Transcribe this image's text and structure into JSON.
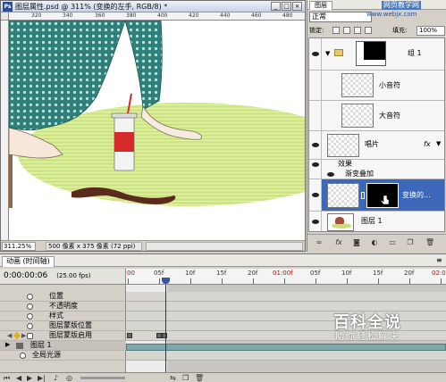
{
  "document": {
    "title": "图层属性.psd @ 311% (变换的左手, RGB/8) *",
    "ruler_labels": [
      "320",
      "340",
      "360",
      "380",
      "400",
      "420",
      "440",
      "460",
      "480",
      "500"
    ],
    "zoom": "311.25%",
    "info": "500 像素 x 375 像素 (72 ppi)"
  },
  "layers_panel": {
    "tab": "图层",
    "blend_mode": "正常",
    "lock_label": "锁定:",
    "fill_label": "填充:",
    "fill_value": "100%",
    "layers": [
      {
        "name": "组 1",
        "visible": true,
        "type": "group"
      },
      {
        "name": "小音符",
        "visible": false,
        "type": "layer"
      },
      {
        "name": "大音符",
        "visible": false,
        "type": "layer"
      },
      {
        "name": "唱片",
        "visible": true,
        "type": "layer",
        "fx": "fx"
      },
      {
        "name": "效果",
        "visible": true,
        "type": "effects-header"
      },
      {
        "name": "渐变叠加",
        "visible": true,
        "type": "effect"
      },
      {
        "name": "变换的...",
        "visible": true,
        "type": "layer",
        "selected": true
      },
      {
        "name": "图层 1",
        "visible": true,
        "type": "layer"
      }
    ]
  },
  "animation_panel": {
    "tab": "动画 (时间轴)",
    "current_time": "0:00:00:06",
    "fps": "(25.00 fps)",
    "frame_labels": [
      "00",
      "05f",
      "10f",
      "15f",
      "20f",
      "01:00f",
      "05f",
      "10f",
      "15f",
      "20f",
      "02:0"
    ],
    "properties": [
      {
        "label": "位置"
      },
      {
        "label": "不透明度"
      },
      {
        "label": "样式"
      },
      {
        "label": "图层蒙版位置"
      },
      {
        "label": "图层蒙版启用"
      },
      {
        "label": "图层 1"
      },
      {
        "label": "全局光源"
      }
    ]
  },
  "watermarks": {
    "site": "网页教学网",
    "url": "www.webjx.com",
    "brand": "百科全说",
    "slogan": "助你轻松解决"
  },
  "colors": {
    "selected_layer": "#3d67b8",
    "timeline_bar": "#7fa8ac",
    "canvas_ellipse": "#c8e07a",
    "dress_pattern": "#2f7f7a"
  }
}
